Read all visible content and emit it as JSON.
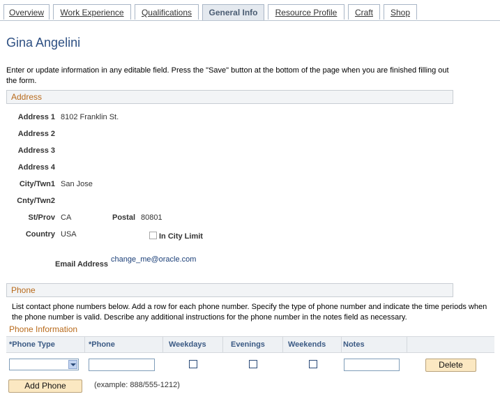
{
  "tabs": [
    "Overview",
    "Work Experience",
    "Qualifications",
    "General Info",
    "Resource Profile",
    "Craft",
    "Shop"
  ],
  "active_tab": "General Info",
  "page_title": "Gina Angelini",
  "intro_text": "Enter or update information in any editable field. Press the \"Save\" button at the bottom of the page when you are finished filling out the form.",
  "address": {
    "section_title": "Address",
    "address1_label": "Address 1",
    "address1": "8102 Franklin St.",
    "address2_label": "Address 2",
    "address3_label": "Address 3",
    "address4_label": "Address 4",
    "city_label": "City/Twn1",
    "city": "San Jose",
    "county_label": "Cnty/Twn2",
    "state_label": "St/Prov",
    "state": "CA",
    "postal_label": "Postal",
    "postal": "80801",
    "country_label": "Country",
    "country": "USA",
    "in_city_limit_label": "In City Limit",
    "email_label": "Email Address",
    "email": "change_me@oracle.com"
  },
  "phone": {
    "section_title": "Phone",
    "description": "List contact phone numbers below. Add a row for each phone number. Specify the type of phone number and indicate the time periods when the phone number is valid. Describe any additional instructions for the phone number in the notes field as necessary.",
    "grid_title": "Phone Information",
    "columns": [
      "*Phone Type",
      "*Phone",
      "Weekdays",
      "Evenings",
      "Weekends",
      "Notes"
    ],
    "row": {
      "phone_type": "",
      "phone": "",
      "notes": ""
    },
    "delete_label": "Delete",
    "add_label": "Add Phone",
    "example": "(example: 888/555-1212)"
  }
}
